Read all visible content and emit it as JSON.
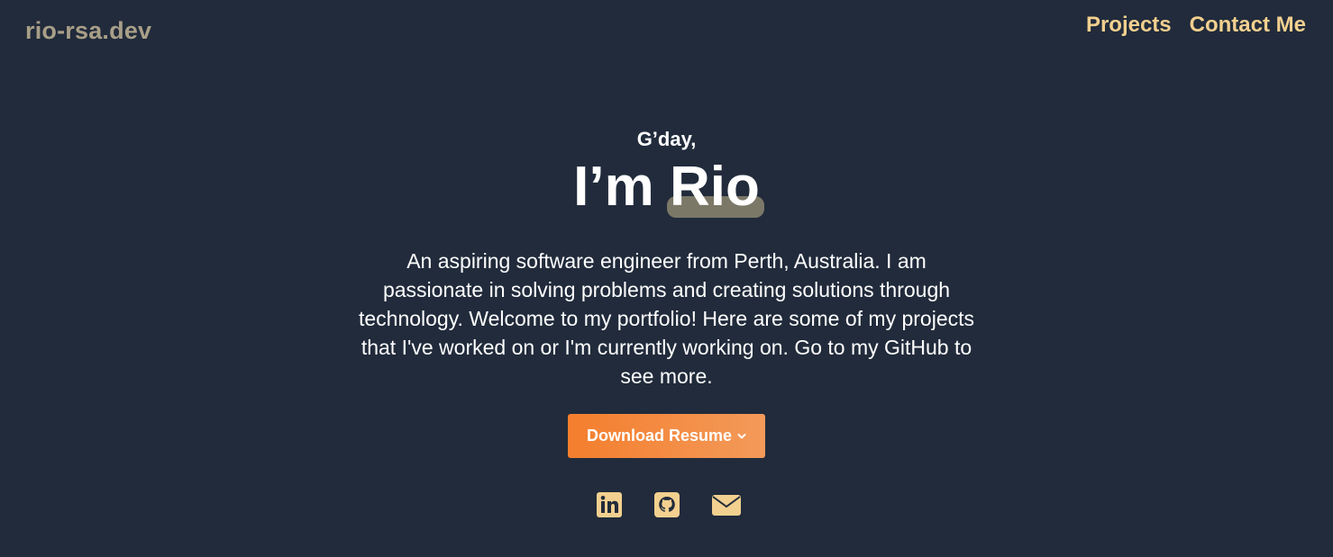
{
  "header": {
    "logo": "rio-rsa.dev",
    "nav": [
      {
        "label": "Projects"
      },
      {
        "label": "Contact Me"
      }
    ]
  },
  "hero": {
    "greeting": "G’day,",
    "headline_prefix": "I’m ",
    "name": "Rio",
    "bio": "An aspiring software engineer from Perth, Australia. I am passionate in solving problems and creating solutions through technology. Welcome to my portfolio! Here are some of my projects that I've worked on or I'm currently working on. Go to my GitHub to see more.",
    "resume_button": "Download Resume"
  },
  "socials": [
    {
      "icon": "linkedin-icon"
    },
    {
      "icon": "github-icon"
    },
    {
      "icon": "envelope-icon"
    }
  ],
  "colors": {
    "background": "#212b3b",
    "logo": "#a89f88",
    "nav": "#f2d08f",
    "accent_start": "#f47e2d",
    "accent_end": "#f39a5a",
    "icon": "#f2d08f",
    "name_highlight": "#7b7868"
  }
}
